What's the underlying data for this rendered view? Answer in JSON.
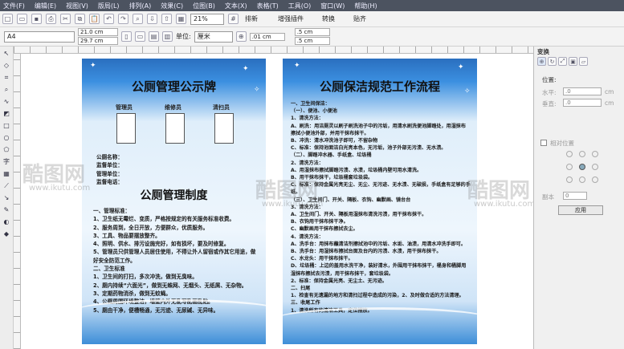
{
  "menu": [
    "文件(F)",
    "编辑(E)",
    "视图(V)",
    "版局(L)",
    "排列(A)",
    "效果(C)",
    "位图(B)",
    "文本(X)",
    "表格(T)",
    "工具(O)",
    "窗口(W)",
    "帮助(H)"
  ],
  "toolbar": {
    "zoom": "21%",
    "btn_arrange": "排新",
    "btn_plugin": "增强插件",
    "btn_convert": "转换",
    "btn_paste": "贴齐"
  },
  "propbar": {
    "page_size": "A4",
    "width": "21.0 cm",
    "height": "29.7 cm",
    "units_label": "单位:",
    "units": "厘米",
    "nudge": ".01 cm",
    "dup_x": ".5 cm",
    "dup_y": ".5 cm"
  },
  "board1": {
    "title": "公厕管理公示牌",
    "photos": [
      "管理员",
      "维修员",
      "清扫员"
    ],
    "info": "公厕名称：\n监督单位：\n管理单位：\n监督电话：",
    "subtitle": "公厕管理制度",
    "body": "一、管理标准：\n1、卫生纸无霉烂、变质，严格按规定的有关服务标准收费。\n2、服务周到，全日开放，方便群众，优质服务。\n3、工具、物品要摆放整齐。\n4、照明、供水、排污设施完好，如有损坏，要及时修复。\n5、管理员只供管理人员居住使用，不得让外人留宿或作其它用途，做好安全防范工作。\n二、卫生标准\n1、卫生间的打扫，多次冲洗，做到无臭味。\n2、厕内持续“六面光”，做到无蛛网、无烟头、无纸屑、无杂物。\n3、定期药物消杀，做到无蚊蝇。\n4、公厕周围环境整洁，墙壁内外无乱写乱画乱贴。\n5、厕由干净，便槽畅通，无污迹、无尿碱、无异味。"
  },
  "board2": {
    "title": "公厕保洁规范工作流程",
    "body": "一、卫生间保洁：\n（一）、便池、小便池\n1、清洗方法：\nA、刷洗：用洁厕灵以刷子刷洗池子中的污垢，用清水刷洗便池脚踏处，用湿抹布擦拭小便池外部，并用干抹布抹干。\nB、冲洗：清水冲洗池子即可，不留杂物\nC、标准：保持池面洁白光亮本色，无污垢，池子外部无污渍、无水渍。\n（二）、脚踏冲水器、手纸盒、垃圾桶\n2、清洗方法：\nA、用湿抹布擦拭脚踏污渍、水渍，垃圾桶内壁可用水清洗。\nB、用干抹布抹干，垃圾桶套垃圾袋。\nC、标准：保持金属光亮无尘、无尘、无污迹、无水渍、无破损，手纸盒有足够的手纸。\n（三）、卫生间门、开关、隔板、衣钩、幽默画、镜台台\n3、清洗方法：\nA、卫生间门、开关、隔板用湿抹布清洗污渍，用干抹布抹干。\nB、衣钩用干抹布抹干净。\nC、幽默画用干抹布擦拭去尘。\n4、清洗方法：\nA、洗手台：用抹布蘸清洁剂擦拭池中的污垢、水垢、油渍，用清水冲洗手即可。\nB、洗手台：用湿抹布擦拭台面及台内的污渍、水渍，用干抹布抹干。\nC、水龙头：用干抹布抹干。\nD、垃圾桶：上边的盖用水洗干净，装好清水，外围用干抹布抹干，桶身和桶脚用湿抹布擦拭去污渍，用干抹布抹干，套垃圾袋。\n2、标准：保持金属光亮、无尘土、无污迹。\n二、扫尾\n1、检查有无遗漏的地方和清扫过程中造成的污染，2、及时做合适的方法清理。\n三、收尾工作\n1、清洗所有的清洁工具，定位摆放。"
  },
  "watermark": {
    "text": "酷图网",
    "url": "www.ikutu.com"
  },
  "docker": {
    "tab": "变换",
    "pos_label": "位置:",
    "h_label": "水平:",
    "h_value": ".0",
    "v_label": "垂直:",
    "v_value": ".0",
    "unit": "cm",
    "rel_label": "相对位置",
    "copies_label": "副本",
    "copies_value": "0",
    "apply": "应用"
  }
}
